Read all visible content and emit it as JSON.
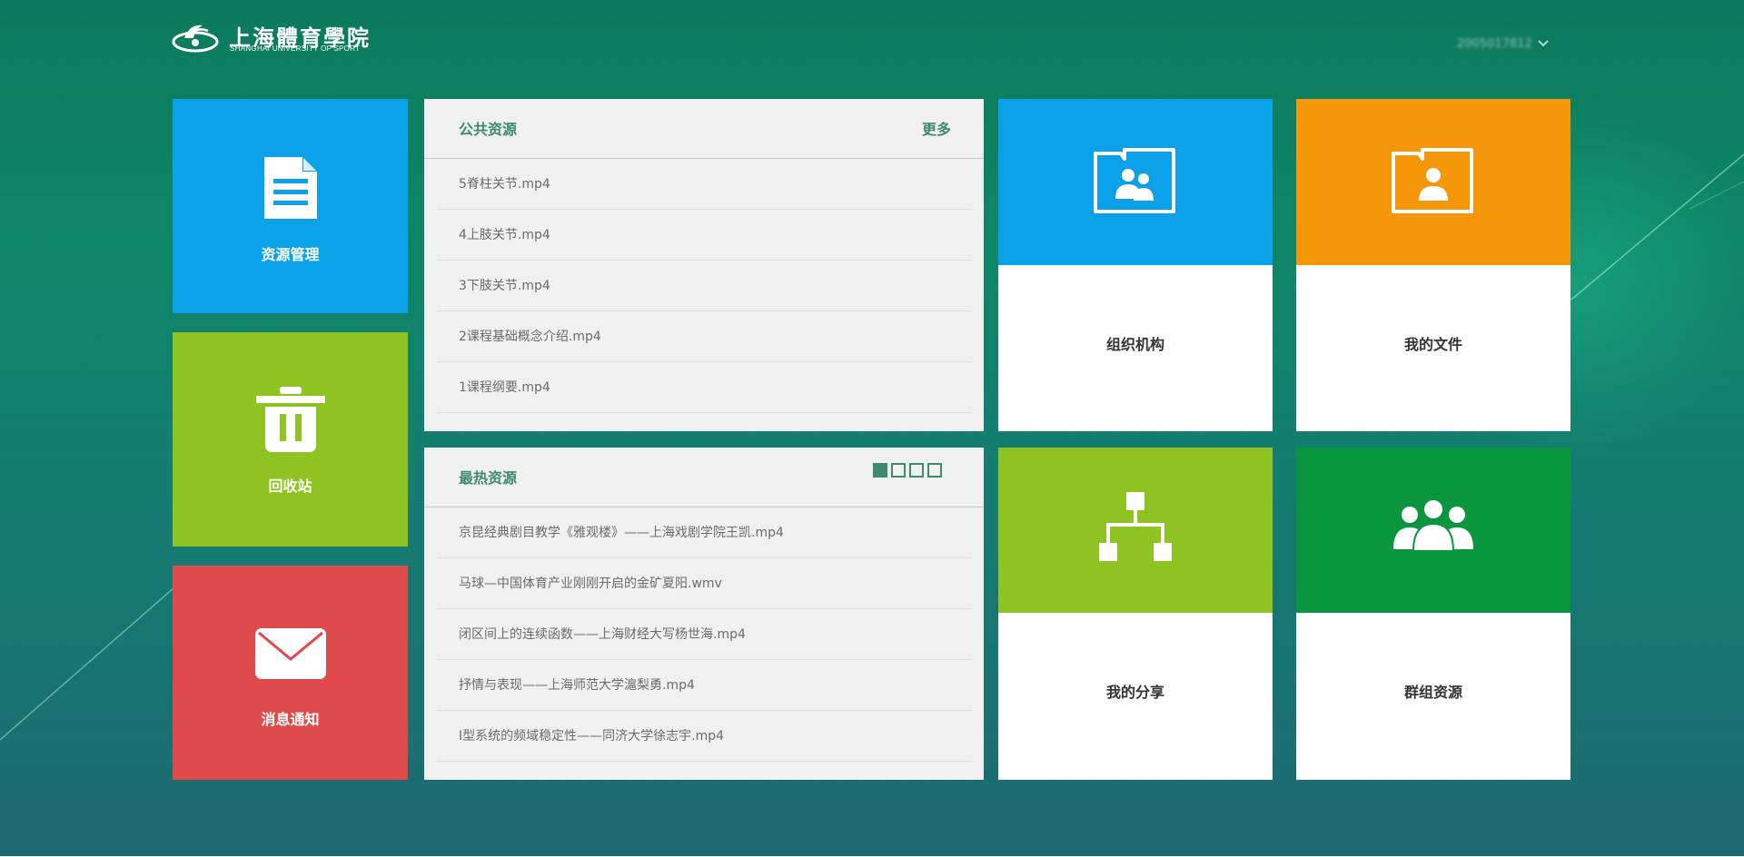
{
  "header": {
    "logo_cn": "上海體育學院",
    "logo_en": "SHANGHAI UNIVERSITY OF SPORT",
    "user_name": "2005017812"
  },
  "tiles": {
    "resource_manage": "资源管理",
    "recycle_bin": "回收站",
    "notifications": "消息通知"
  },
  "public_resources": {
    "title": "公共资源",
    "more": "更多",
    "items": [
      "5脊柱关节.mp4",
      "4上肢关节.mp4",
      "3下肢关节.mp4",
      "2课程基础概念介绍.mp4",
      "1课程纲要.mp4"
    ]
  },
  "hot_resources": {
    "title": "最热资源",
    "pages": 4,
    "current_page": 1,
    "items": [
      "京昆经典剧目教学《雅观楼》——上海戏剧学院王凯.mp4",
      "马球—中国体育产业刚刚开启的金矿夏阳.wmv",
      "闭区间上的连续函数——上海财经大写杨世海.mp4",
      "抒情与表现——上海师范大学滬梨勇.mp4",
      "I型系统的频域稳定性——同济大学徐志宇.mp4"
    ]
  },
  "cards": {
    "organization": "组织机构",
    "my_files": "我的文件",
    "my_share": "我的分享",
    "group_resources": "群组资源"
  },
  "colors": {
    "blue": "#0ba1e8",
    "lime": "#8ec321",
    "red": "#df4a4a",
    "orange": "#f6970a",
    "green": "#09963e",
    "panel_title": "#3e8a6a"
  }
}
